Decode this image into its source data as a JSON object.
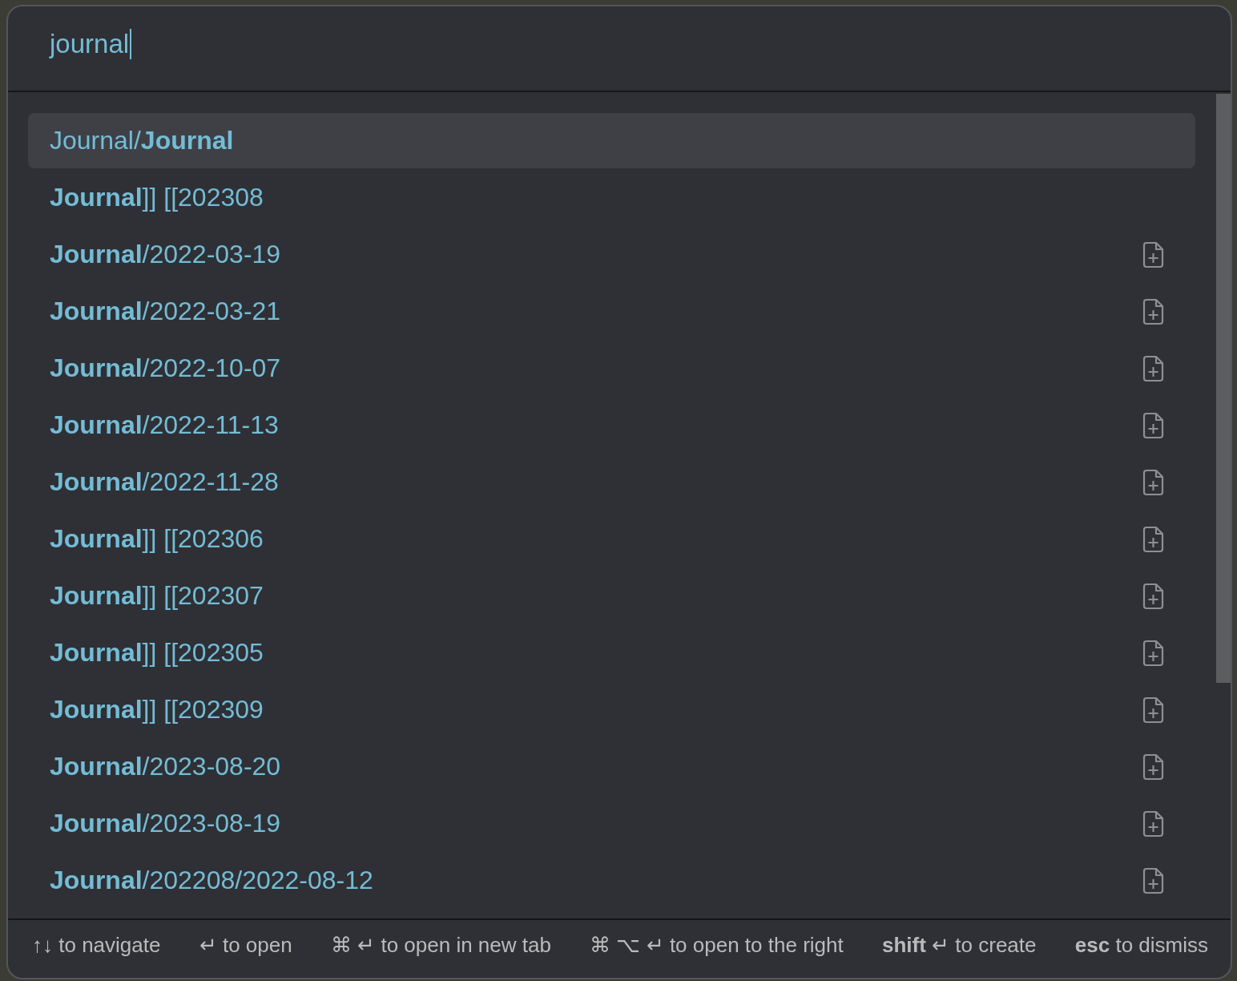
{
  "search": {
    "value": "journal"
  },
  "results": [
    {
      "text": "Journal/**Journal**",
      "selected": true,
      "kind": "note"
    },
    {
      "text": "**Journal**]] [[202308",
      "selected": false,
      "kind": "note"
    },
    {
      "text": "**Journal**/2022-03-19",
      "selected": false,
      "kind": "unresolved"
    },
    {
      "text": "**Journal**/2022-03-21",
      "selected": false,
      "kind": "unresolved"
    },
    {
      "text": "**Journal**/2022-10-07",
      "selected": false,
      "kind": "unresolved"
    },
    {
      "text": "**Journal**/2022-11-13",
      "selected": false,
      "kind": "unresolved"
    },
    {
      "text": "**Journal**/2022-11-28",
      "selected": false,
      "kind": "unresolved"
    },
    {
      "text": "**Journal**]] [[202306",
      "selected": false,
      "kind": "unresolved"
    },
    {
      "text": "**Journal**]] [[202307",
      "selected": false,
      "kind": "unresolved"
    },
    {
      "text": "**Journal**]] [[202305",
      "selected": false,
      "kind": "unresolved"
    },
    {
      "text": "**Journal**]] [[202309",
      "selected": false,
      "kind": "unresolved"
    },
    {
      "text": "**Journal**/2023-08-20",
      "selected": false,
      "kind": "unresolved"
    },
    {
      "text": "**Journal**/2023-08-19",
      "selected": false,
      "kind": "unresolved"
    },
    {
      "text": "**Journal**/202208/2022-08-12",
      "selected": false,
      "kind": "unresolved"
    }
  ],
  "hints": [
    "↑↓ to navigate",
    "↵ to open",
    "⌘ ↵ to open in new tab",
    "⌘ ⌥ ↵ to open to the right",
    "**shift** ↵ to create",
    "**esc** to dismiss"
  ]
}
